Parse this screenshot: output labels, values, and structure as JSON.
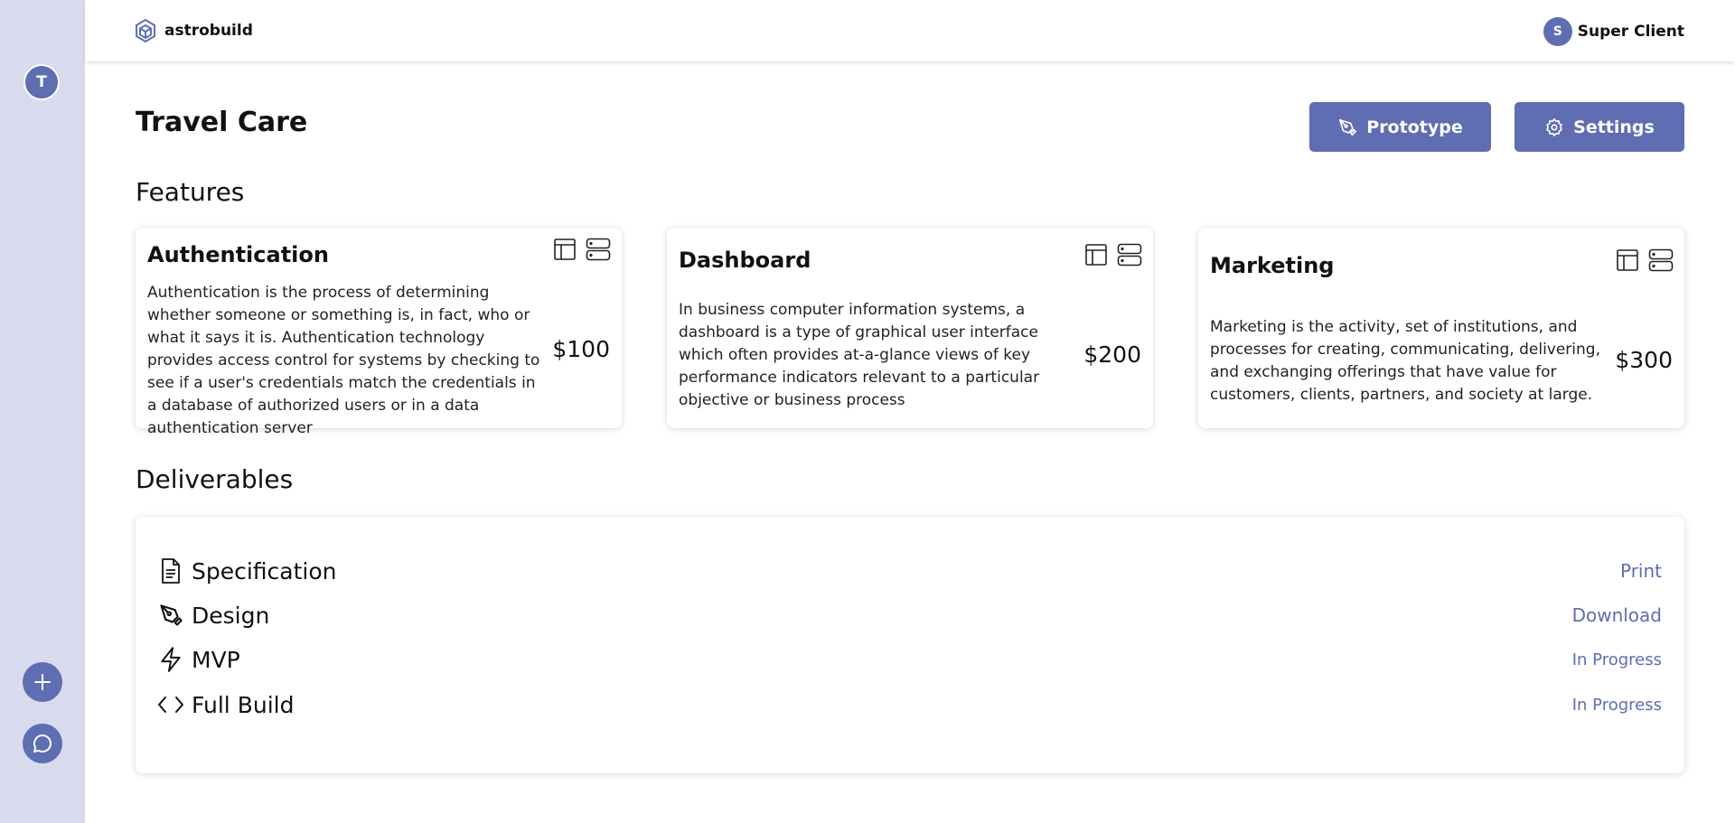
{
  "app": {
    "logo_text": "astrobuild"
  },
  "sidebar": {
    "avatar_letter": "T"
  },
  "user": {
    "initial": "S",
    "name": "Super Client"
  },
  "page": {
    "title": "Travel Care"
  },
  "actions": {
    "prototype_label": "Prototype",
    "settings_label": "Settings"
  },
  "sections": {
    "features": "Features",
    "deliverables": "Deliverables"
  },
  "features": [
    {
      "title": "Authentication",
      "description": "Authentication is the process of determining whether someone or something is, in fact, who or what it says it is. Authentication technology provides access control for systems by checking to see if a user's credentials match the credentials in a database of authorized users or in a data authentication server",
      "price": "$100"
    },
    {
      "title": "Dashboard",
      "description": "In business computer information systems, a dashboard is a type of graphical user interface which often provides at-a-glance views of key performance indicators relevant to a particular objective or business process",
      "price": "$200"
    },
    {
      "title": "Marketing",
      "description": "Marketing is the activity, set of institutions, and processes for creating, communicating, delivering, and exchanging offerings that have value for customers, clients, partners, and society at large.",
      "price": "$300"
    }
  ],
  "deliverables": [
    {
      "label": "Specification",
      "action": "Print",
      "icon": "document-icon"
    },
    {
      "label": "Design",
      "action": "Download",
      "icon": "pen-tool-icon"
    },
    {
      "label": "MVP",
      "status": "In Progress",
      "icon": "lightning-icon"
    },
    {
      "label": "Full Build",
      "status": "In Progress",
      "icon": "code-icon"
    }
  ],
  "colors": {
    "accent": "#5f6db3",
    "sidebar_bg": "#d8dbee"
  }
}
